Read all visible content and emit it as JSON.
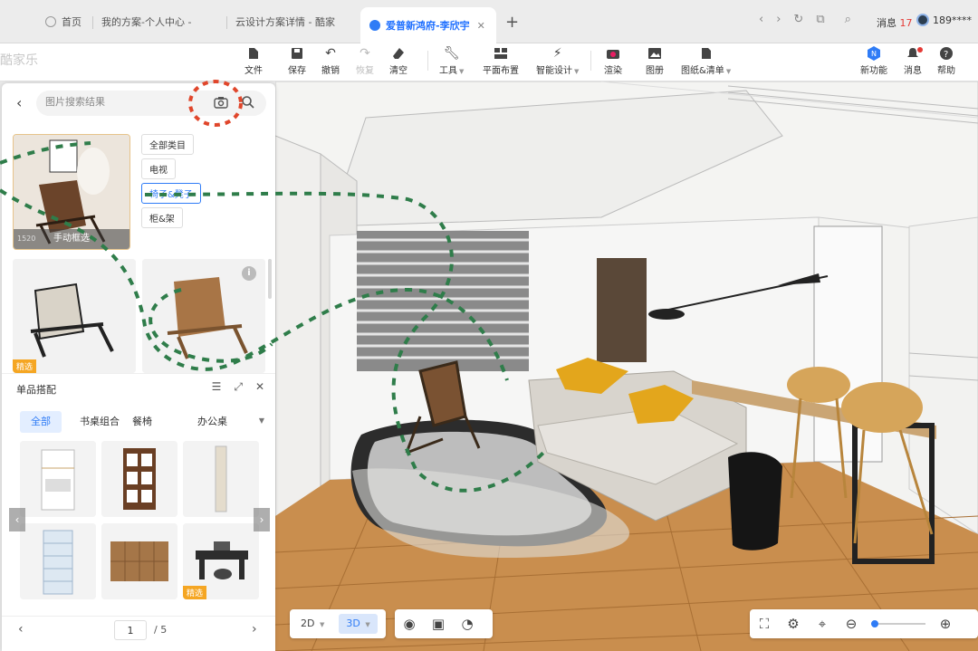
{
  "browser": {
    "tabs": [
      {
        "label": "首页"
      },
      {
        "label": "我的方案-个人中心 -"
      },
      {
        "label": "云设计方案详情 - 酷家"
      },
      {
        "label": "爱普新鸿府-李欣宇"
      }
    ],
    "messages_label": "消息",
    "messages_count": "17",
    "user": "189****"
  },
  "app": {
    "logo": "酷家乐",
    "toolbar": [
      {
        "label": "文件",
        "icon": "file-icon"
      },
      {
        "label": "保存",
        "icon": "save-icon"
      },
      {
        "label": "撤销",
        "icon": "undo-icon"
      },
      {
        "label": "恢复",
        "icon": "redo-icon"
      },
      {
        "label": "清空",
        "icon": "eraser-icon"
      },
      {
        "label": "工具",
        "icon": "wrench-icon"
      },
      {
        "label": "平面布置",
        "icon": "layout-icon"
      },
      {
        "label": "智能设计",
        "icon": "smart-design-icon"
      },
      {
        "label": "渲染",
        "icon": "camera-icon"
      },
      {
        "label": "图册",
        "icon": "album-icon"
      },
      {
        "label": "图纸&清单",
        "icon": "drawing-icon"
      }
    ],
    "right_buttons": [
      {
        "label": "新功能",
        "icon": "new-feature-icon"
      },
      {
        "label": "消息",
        "icon": "bell-icon"
      },
      {
        "label": "帮助",
        "icon": "help-icon"
      }
    ]
  },
  "search_panel": {
    "placeholder": "图片搜索结果",
    "thumb_caption": "手动框选",
    "thumb_size": "1520",
    "categories": [
      "全部类目",
      "电视",
      "椅子&凳子",
      "柜&架"
    ],
    "active_category": "椅子&凳子",
    "results": [
      {
        "badge": "精选"
      },
      {
        "badge": ""
      }
    ]
  },
  "match_panel": {
    "title": "单品搭配",
    "tabs": [
      "全部",
      "书桌组合",
      "餐椅",
      "办公桌"
    ],
    "active_tab": "全部",
    "items": [
      {
        "name": "cabinet",
        "badge": ""
      },
      {
        "name": "bookshelf",
        "badge": ""
      },
      {
        "name": "tall-cabinet",
        "badge": ""
      },
      {
        "name": "glass-shelf",
        "badge": ""
      },
      {
        "name": "wood-wall-panel",
        "badge": ""
      },
      {
        "name": "desk-set",
        "badge": "精选"
      }
    ],
    "page_current": "1",
    "page_total": "/ 5"
  },
  "view_controls": {
    "mode_2d": "2D",
    "mode_3d": "3D",
    "active_mode": "3D"
  }
}
